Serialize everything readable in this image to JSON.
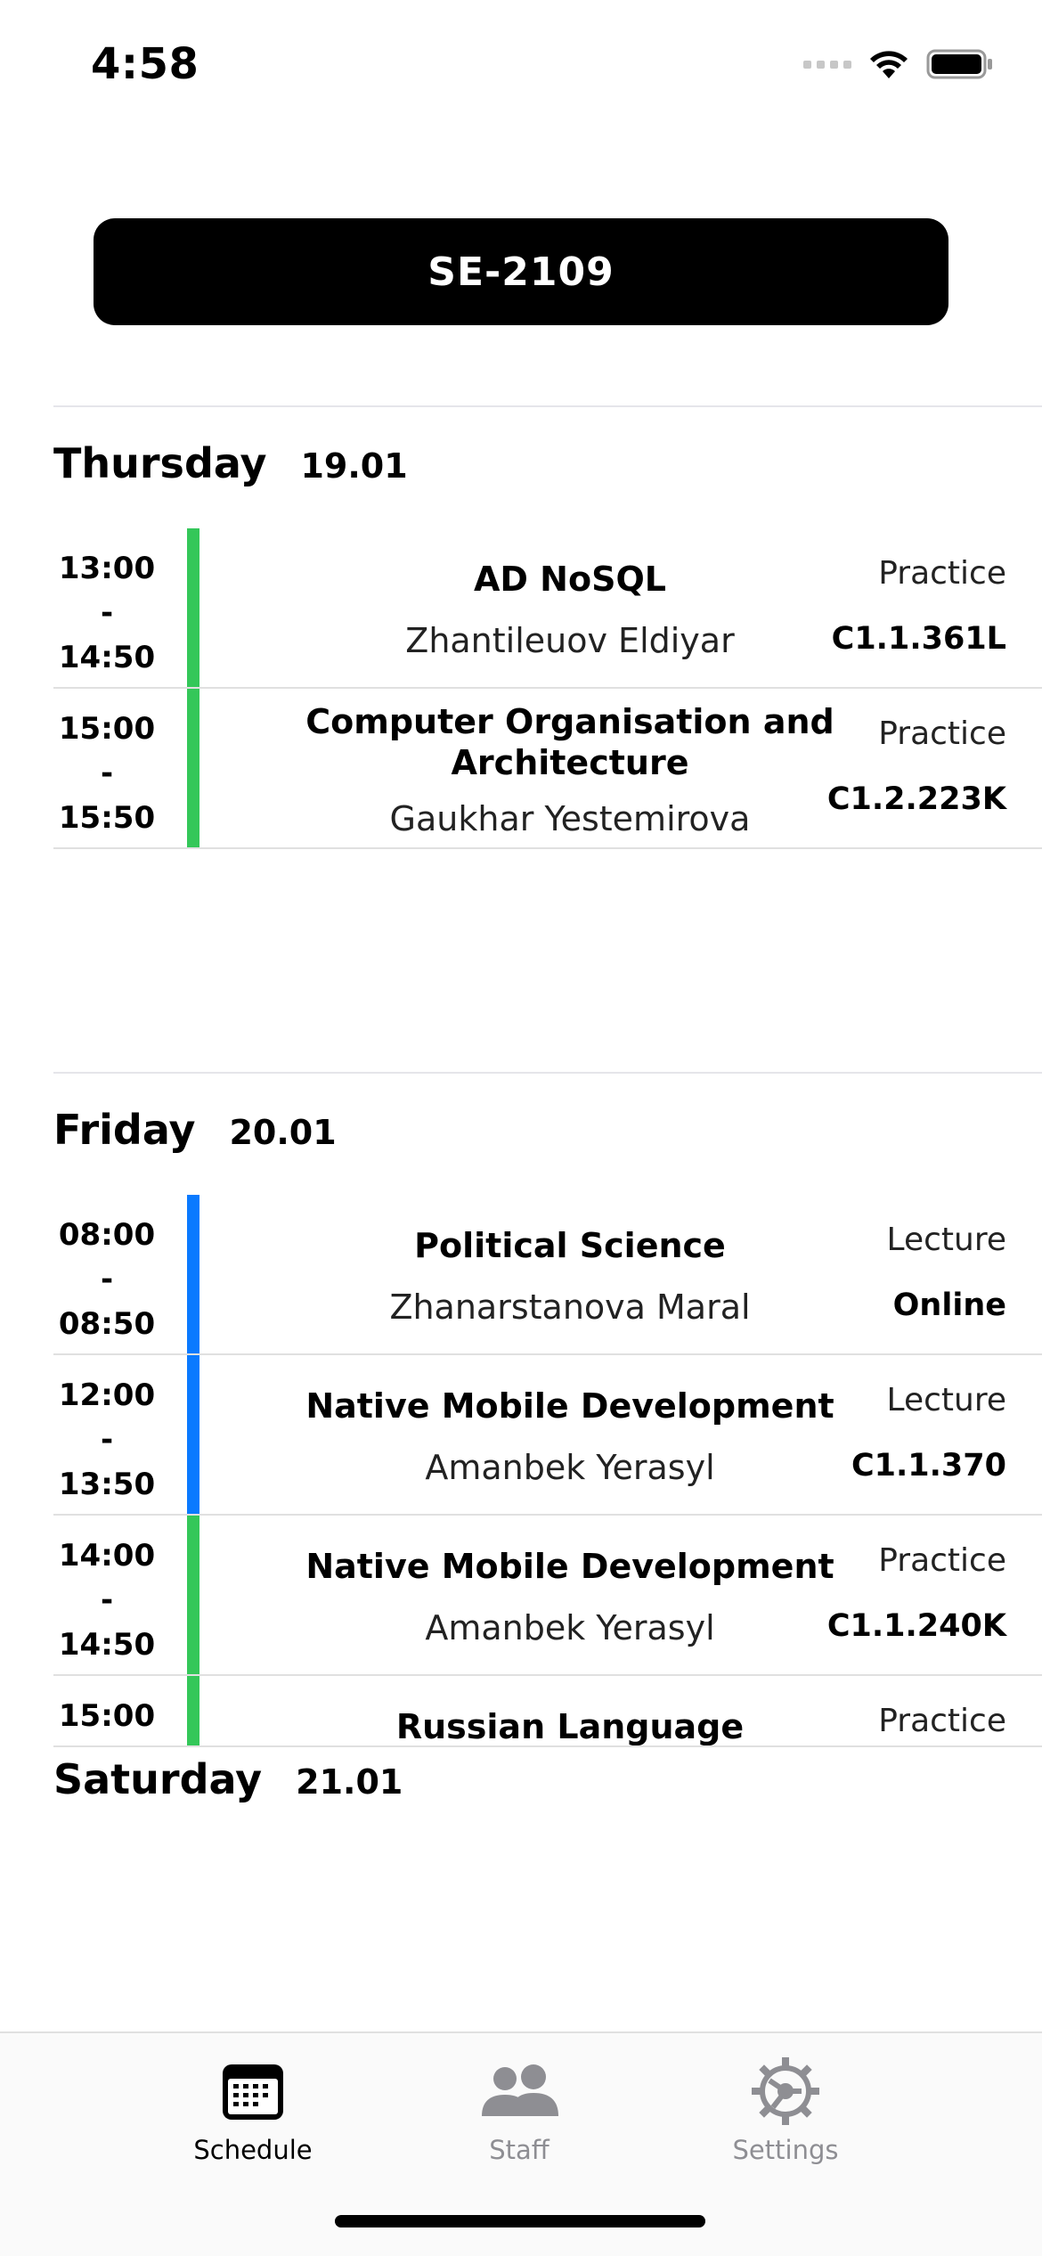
{
  "status": {
    "time": "4:58"
  },
  "group": {
    "label": "SE-2109"
  },
  "days": [
    {
      "name": "Thursday",
      "date": "19.01",
      "lessons": [
        {
          "start": "13:00",
          "sep": "-",
          "end": "14:50",
          "subject": "AD NoSQL",
          "teacher": "Zhantileuov Eldiyar",
          "type": "Practice",
          "room": "C1.1.361L",
          "color": "#34c759"
        },
        {
          "start": "15:00",
          "sep": "-",
          "end": "15:50",
          "subject": "Computer Organisation and Architecture",
          "teacher": "Gaukhar Yestemirova",
          "type": "Practice",
          "room": "C1.2.223K",
          "color": "#34c759"
        }
      ]
    },
    {
      "name": "Friday",
      "date": "20.01",
      "lessons": [
        {
          "start": "08:00",
          "sep": "-",
          "end": "08:50",
          "subject": "Political Science",
          "teacher": "Zhanarstanova Maral",
          "type": "Lecture",
          "room": "Online",
          "color": "#0a7aff"
        },
        {
          "start": "12:00",
          "sep": "-",
          "end": "13:50",
          "subject": "Native Mobile Development",
          "teacher": "Amanbek Yerasyl",
          "type": "Lecture",
          "room": "C1.1.370",
          "color": "#0a7aff"
        },
        {
          "start": "14:00",
          "sep": "-",
          "end": "14:50",
          "subject": "Native Mobile Development",
          "teacher": "Amanbek Yerasyl",
          "type": "Practice",
          "room": "C1.1.240K",
          "color": "#34c759"
        },
        {
          "start": "15:00",
          "subject": "Russian Language",
          "type": "Practice",
          "color": "#34c759"
        }
      ]
    },
    {
      "name": "Saturday",
      "date": "21.01"
    }
  ],
  "tabs": [
    {
      "label": "Schedule",
      "icon": "calendar-icon",
      "active": true
    },
    {
      "label": "Staff",
      "icon": "people-icon",
      "active": false
    },
    {
      "label": "Settings",
      "icon": "gear-icon",
      "active": false
    }
  ]
}
